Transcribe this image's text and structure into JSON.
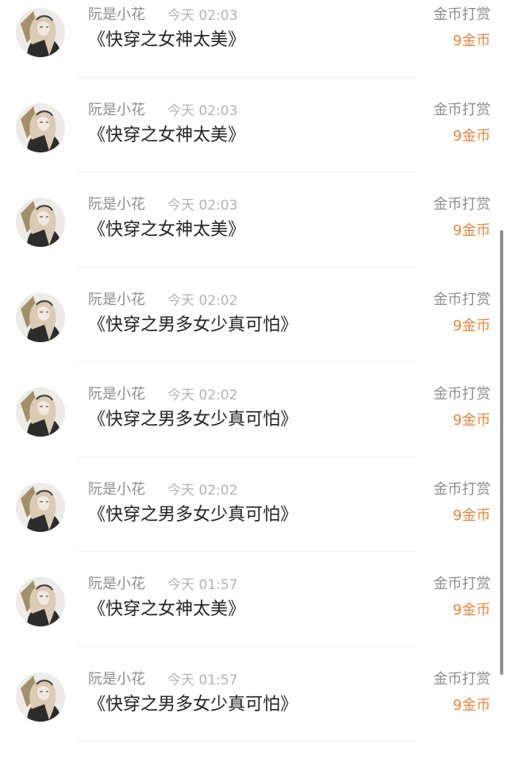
{
  "reward_list": [
    {
      "user": "阮是小花",
      "time": "今天 02:03",
      "book": "《快穿之女神太美》",
      "type": "金币打赏",
      "amount": "9金币"
    },
    {
      "user": "阮是小花",
      "time": "今天 02:03",
      "book": "《快穿之女神太美》",
      "type": "金币打赏",
      "amount": "9金币"
    },
    {
      "user": "阮是小花",
      "time": "今天 02:03",
      "book": "《快穿之女神太美》",
      "type": "金币打赏",
      "amount": "9金币"
    },
    {
      "user": "阮是小花",
      "time": "今天 02:02",
      "book": "《快穿之男多女少真可怕》",
      "type": "金币打赏",
      "amount": "9金币"
    },
    {
      "user": "阮是小花",
      "time": "今天 02:02",
      "book": "《快穿之男多女少真可怕》",
      "type": "金币打赏",
      "amount": "9金币"
    },
    {
      "user": "阮是小花",
      "time": "今天 02:02",
      "book": "《快穿之男多女少真可怕》",
      "type": "金币打赏",
      "amount": "9金币"
    },
    {
      "user": "阮是小花",
      "time": "今天 01:57",
      "book": "《快穿之女神太美》",
      "type": "金币打赏",
      "amount": "9金币"
    },
    {
      "user": "阮是小花",
      "time": "今天 01:57",
      "book": "《快穿之男多女少真可怕》",
      "type": "金币打赏",
      "amount": "9金币"
    }
  ],
  "colors": {
    "accent_amount": "#e8853a",
    "secondary_text": "#8d8d8d",
    "time_text": "#b3b3b3",
    "primary_text": "#222222"
  },
  "icons": {
    "avatar": "user-avatar-illustration"
  }
}
